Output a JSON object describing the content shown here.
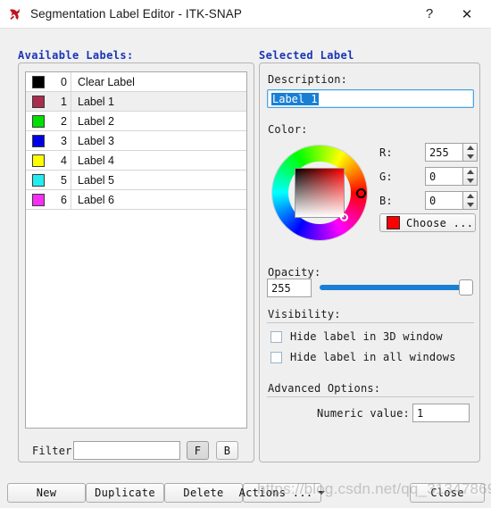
{
  "window": {
    "title": "Segmentation Label Editor - ITK-SNAP",
    "app_icon": "itk-snap-logo-icon",
    "help_glyph": "?",
    "close_glyph": "✕"
  },
  "available_labels": {
    "header": "Available Labels:",
    "columns": [
      "color",
      "index",
      "description"
    ],
    "rows": [
      {
        "index": "0",
        "name": "Clear Label",
        "color": "#000000",
        "selected": false
      },
      {
        "index": "1",
        "name": "Label 1",
        "color": "#a82d4e",
        "selected": true
      },
      {
        "index": "2",
        "name": "Label 2",
        "color": "#00e000",
        "selected": false
      },
      {
        "index": "3",
        "name": "Label 3",
        "color": "#0000e6",
        "selected": false
      },
      {
        "index": "4",
        "name": "Label 4",
        "color": "#ffff00",
        "selected": false
      },
      {
        "index": "5",
        "name": "Label 5",
        "color": "#22eef0",
        "selected": false
      },
      {
        "index": "6",
        "name": "Label 6",
        "color": "#f52ef5",
        "selected": false
      }
    ],
    "filter": {
      "label": "Filter:",
      "value": "",
      "placeholder": "",
      "buttons": [
        {
          "label": "F",
          "pressed": true
        },
        {
          "label": "B",
          "pressed": false
        }
      ]
    }
  },
  "selected_label": {
    "header": "Selected Label",
    "description": {
      "label": "Description:",
      "value": "Label 1",
      "selected_text": true
    },
    "color": {
      "label": "Color:",
      "wheel": "hue-wheel",
      "hue_degrees": 0,
      "channels": [
        {
          "label": "R:",
          "value": "255"
        },
        {
          "label": "G:",
          "value": "0"
        },
        {
          "label": "B:",
          "value": "0"
        }
      ],
      "choose_button": "Choose ...",
      "choose_swatch": "#ff0000"
    },
    "opacity": {
      "label": "Opacity:",
      "value": "255",
      "min": 0,
      "max": 255,
      "slider_percent": 100,
      "accent": "#1a7fd4"
    },
    "visibility": {
      "label": "Visibility:",
      "options": [
        {
          "label": "Hide label in 3D window",
          "checked": false
        },
        {
          "label": "Hide label in all windows",
          "checked": false
        }
      ]
    },
    "advanced": {
      "label": "Advanced Options:",
      "numeric_label": "Numeric value:",
      "numeric_value": "1"
    }
  },
  "footer": {
    "buttons": [
      {
        "label": "New"
      },
      {
        "label": "Duplicate"
      },
      {
        "label": "Delete"
      },
      {
        "label": "Actions ..."
      },
      {
        "label": "Close"
      }
    ]
  },
  "watermark": "https://blog.csdn.net/qq_31347869"
}
